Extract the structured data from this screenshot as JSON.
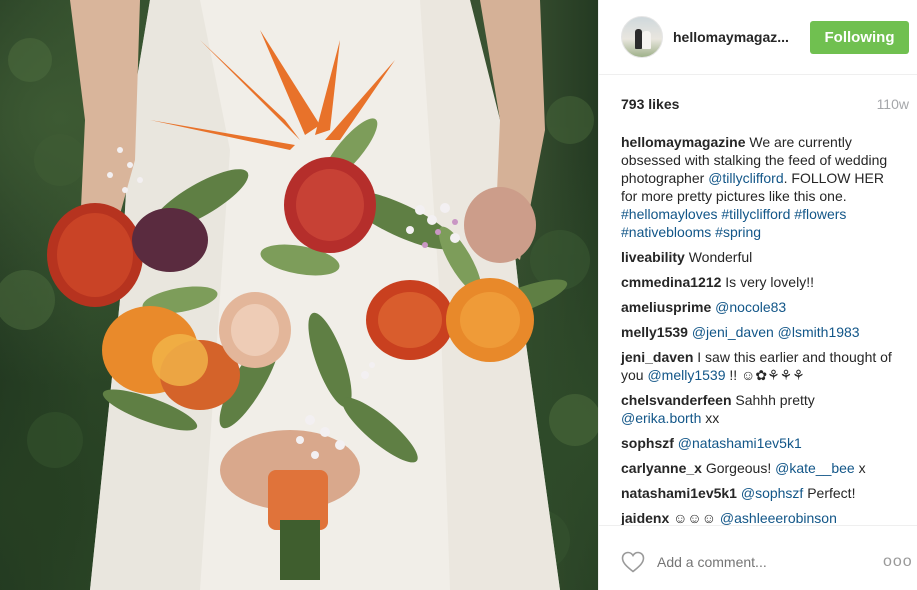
{
  "header": {
    "username": "hellomaymagaz...",
    "follow_label": "Following"
  },
  "meta": {
    "likes": "793 likes",
    "age": "110w"
  },
  "caption": {
    "user": "hellomaymagazine",
    "t1": " We are currently obsessed with stalking the feed of wedding photographer ",
    "m1": "@tillyclifford",
    "t2": ". FOLLOW HER for more pretty pictures like this one. ",
    "h1": "#hellomayloves",
    "t3": " ",
    "h2": "#tillyclifford",
    "t4": " ",
    "h3": "#flowers",
    "t5": " ",
    "h4": "#nativeblooms",
    "t6": " ",
    "h5": "#spring"
  },
  "comments": [
    {
      "user": "liveability",
      "text": " Wonderful"
    },
    {
      "user": "cmmedina1212",
      "text": " Is very lovely!!"
    },
    {
      "user": "ameliusprime",
      "text": " ",
      "m1": "@nocole83"
    },
    {
      "user": "melly1539",
      "text": " ",
      "m1": "@jeni_daven",
      "t2": " ",
      "m2": "@lsmith1983"
    },
    {
      "user": "jeni_daven",
      "text": " I saw this earlier and thought of you ",
      "m1": "@melly1539",
      "t2": " !! ☺✿⚘⚘⚘"
    },
    {
      "user": "chelsvanderfeen",
      "text": " Sahhh pretty ",
      "m1": "@erika.borth",
      "t2": " xx"
    },
    {
      "user": "sophszf",
      "text": " ",
      "m1": "@natashami1ev5k1"
    },
    {
      "user": "carlyanne_x",
      "text": " Gorgeous! ",
      "m1": "@kate__bee",
      "t2": " x"
    },
    {
      "user": "natashami1ev5k1",
      "text": " ",
      "m1": "@sophszf",
      "t2": " Perfect!"
    },
    {
      "user": "jaidenx",
      "text": " ☺☺☺ ",
      "m1": "@ashleeerobinson"
    }
  ],
  "footer": {
    "placeholder": "Add a comment...",
    "more": "ooo"
  },
  "icons": {
    "like": "heart-outline-icon",
    "more": "more-options-icon"
  },
  "colors": {
    "follow_button": "#70c050",
    "link": "#125688",
    "muted": "#a5a7aa"
  }
}
